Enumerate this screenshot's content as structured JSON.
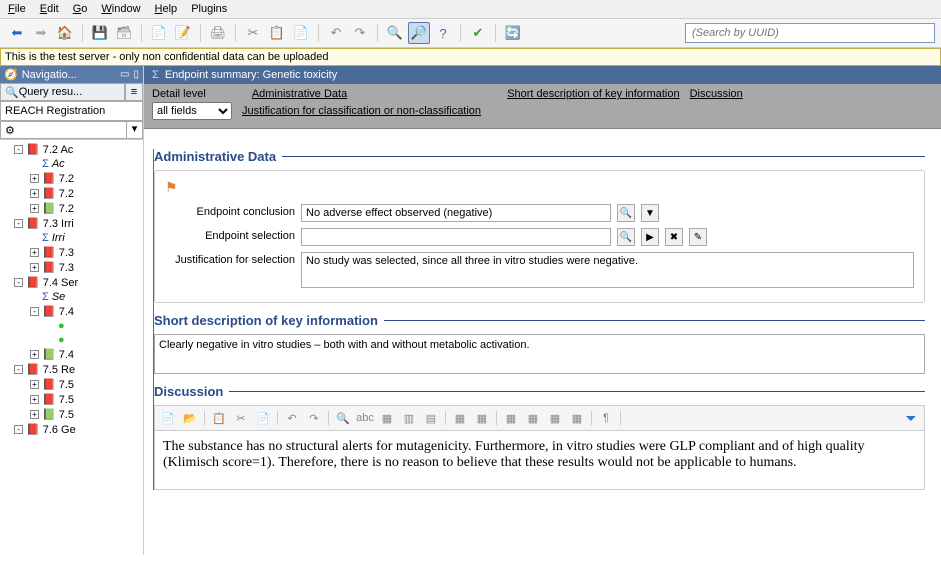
{
  "menubar": {
    "file": "File",
    "edit": "Edit",
    "go": "Go",
    "window": "Window",
    "help": "Help",
    "plugins": "Plugins"
  },
  "search": {
    "placeholder": "(Search by UUID)"
  },
  "banner": "This is the test server - only non confidential data can be uploaded",
  "nav": {
    "title": "Navigatio...",
    "query_tab": "Query resu...",
    "reach": "REACH Registration"
  },
  "tree": {
    "n1": "7.2 Ac",
    "n1a": "Ac",
    "n1b": "7.2",
    "n1c": "7.2",
    "n1d": "7.2",
    "n2": "7.3 Irri",
    "n2a": "Irri",
    "n2b": "7.3",
    "n2c": "7.3",
    "n3": "7.4 Ser",
    "n3a": "Se",
    "n3b": "7.4",
    "n3c": "",
    "n3bb": "",
    "n3d": "7.4",
    "n4": "7.5 Re",
    "n4a": "7.5",
    "n4b": "7.5",
    "n4c": "7.5",
    "n5": "7.6 Ge"
  },
  "main_title": "Endpoint summary: Genetic toxicity",
  "detail_level_lbl": "Detail level",
  "detail_level_val": "all fields",
  "link_admin": "Administrative Data",
  "link_short": "Short description of key information",
  "link_disc": "Discussion",
  "link_just": "Justification for classification or non-classification",
  "sec_admin": "Administrative Data",
  "lbl_conclusion": "Endpoint conclusion",
  "val_conclusion": "No adverse effect observed (negative)",
  "lbl_selection": "Endpoint selection",
  "val_selection": "",
  "lbl_justsel": "Justification for selection",
  "val_justsel": "No study was selected, since all three  in vitro studies were negative.",
  "sec_short": "Short description of key information",
  "val_short": "Clearly negative in vitro studies – both with and without metabolic activation.",
  "sec_disc": "Discussion",
  "val_disc": "The substance has no structural alerts for mutagenicity. Furthermore, in vitro studies were GLP compliant and of high quality (Klimisch score=1). Therefore, there is no reason to believe that these results would not be applicable to humans."
}
